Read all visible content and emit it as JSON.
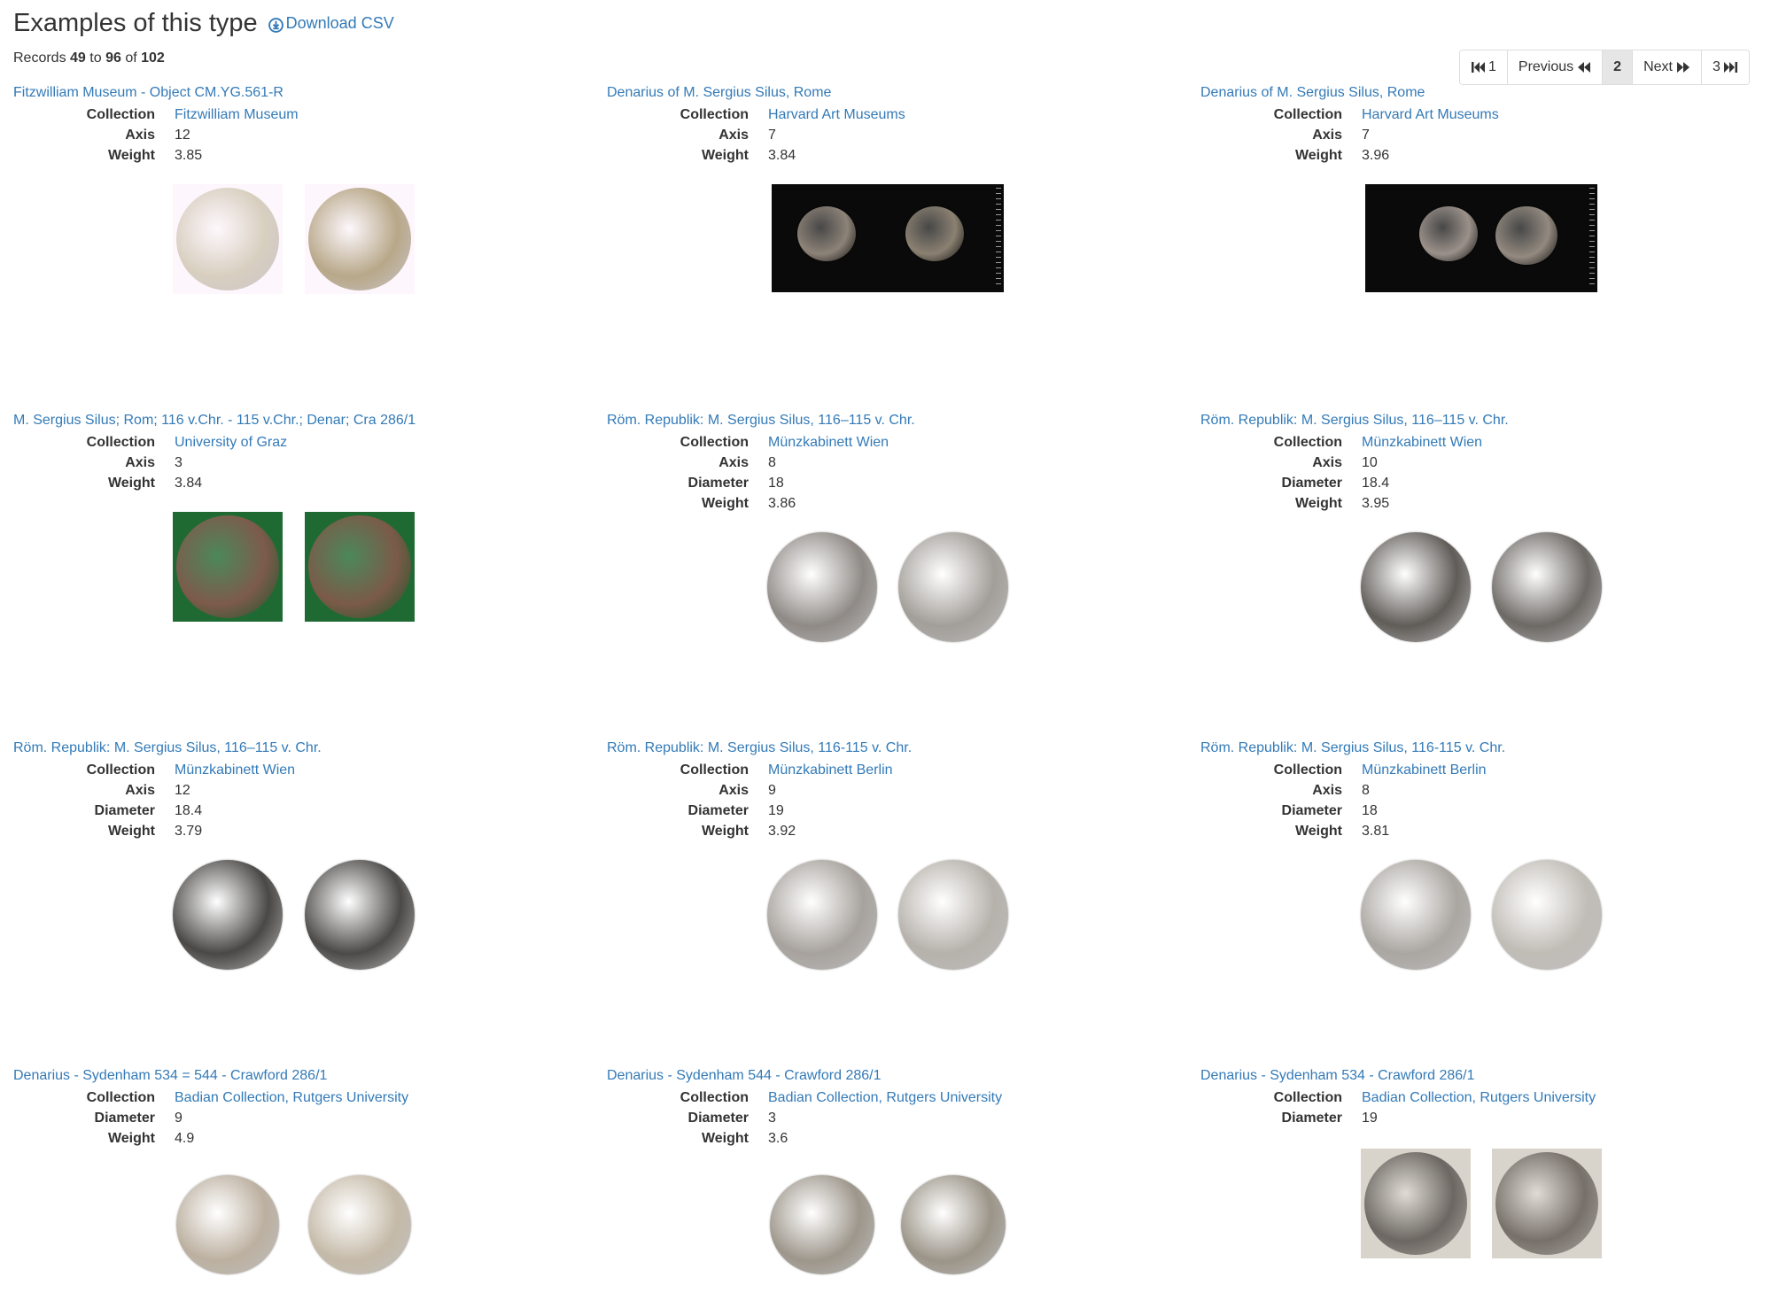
{
  "header": {
    "title": "Examples of this type",
    "download_label": "Download CSV"
  },
  "records": {
    "prefix": "Records",
    "from": "49",
    "to_word": "to",
    "to": "96",
    "of_word": "of",
    "total": "102"
  },
  "pagination": {
    "first": "1",
    "previous": "Previous",
    "current": "2",
    "next": "Next",
    "last": "3"
  },
  "cards": [
    {
      "title": "Fitzwilliam Museum - Object CM.YG.561-R",
      "props": [
        {
          "label": "Collection",
          "value": "Fitzwilliam Museum",
          "link": true
        },
        {
          "label": "Axis",
          "value": "12"
        },
        {
          "label": "Weight",
          "value": "3.85"
        }
      ]
    },
    {
      "title": "Denarius of M. Sergius Silus, Rome",
      "props": [
        {
          "label": "Collection",
          "value": "Harvard Art Museums",
          "link": true
        },
        {
          "label": "Axis",
          "value": "7"
        },
        {
          "label": "Weight",
          "value": "3.84"
        }
      ]
    },
    {
      "title": "Denarius of M. Sergius Silus, Rome",
      "props": [
        {
          "label": "Collection",
          "value": "Harvard Art Museums",
          "link": true
        },
        {
          "label": "Axis",
          "value": "7"
        },
        {
          "label": "Weight",
          "value": "3.96"
        }
      ]
    },
    {
      "title": "M. Sergius Silus; Rom; 116 v.Chr. - 115 v.Chr.; Denar; Cra 286/1",
      "props": [
        {
          "label": "Collection",
          "value": "University of Graz",
          "link": true
        },
        {
          "label": "Axis",
          "value": "3"
        },
        {
          "label": "Weight",
          "value": "3.84"
        }
      ]
    },
    {
      "title": "Röm. Republik: M. Sergius Silus, 116–115 v. Chr.",
      "props": [
        {
          "label": "Collection",
          "value": "Münzkabinett Wien",
          "link": true
        },
        {
          "label": "Axis",
          "value": "8"
        },
        {
          "label": "Diameter",
          "value": "18"
        },
        {
          "label": "Weight",
          "value": "3.86"
        }
      ]
    },
    {
      "title": "Röm. Republik: M. Sergius Silus, 116–115 v. Chr.",
      "props": [
        {
          "label": "Collection",
          "value": "Münzkabinett Wien",
          "link": true
        },
        {
          "label": "Axis",
          "value": "10"
        },
        {
          "label": "Diameter",
          "value": "18.4"
        },
        {
          "label": "Weight",
          "value": "3.95"
        }
      ]
    },
    {
      "title": "Röm. Republik: M. Sergius Silus, 116–115 v. Chr.",
      "props": [
        {
          "label": "Collection",
          "value": "Münzkabinett Wien",
          "link": true
        },
        {
          "label": "Axis",
          "value": "12"
        },
        {
          "label": "Diameter",
          "value": "18.4"
        },
        {
          "label": "Weight",
          "value": "3.79"
        }
      ]
    },
    {
      "title": "Röm. Republik: M. Sergius Silus, 116-115 v. Chr.",
      "props": [
        {
          "label": "Collection",
          "value": "Münzkabinett Berlin",
          "link": true
        },
        {
          "label": "Axis",
          "value": "9"
        },
        {
          "label": "Diameter",
          "value": "19"
        },
        {
          "label": "Weight",
          "value": "3.92"
        }
      ]
    },
    {
      "title": "Röm. Republik: M. Sergius Silus, 116-115 v. Chr.",
      "props": [
        {
          "label": "Collection",
          "value": "Münzkabinett Berlin",
          "link": true
        },
        {
          "label": "Axis",
          "value": "8"
        },
        {
          "label": "Diameter",
          "value": "18"
        },
        {
          "label": "Weight",
          "value": "3.81"
        }
      ]
    },
    {
      "title": "Denarius - Sydenham 534 = 544 - Crawford 286/1",
      "props": [
        {
          "label": "Collection",
          "value": "Badian Collection, Rutgers University",
          "link": true
        },
        {
          "label": "Diameter",
          "value": "9"
        },
        {
          "label": "Weight",
          "value": "4.9"
        }
      ]
    },
    {
      "title": "Denarius - Sydenham 544 - Crawford 286/1",
      "props": [
        {
          "label": "Collection",
          "value": "Badian Collection, Rutgers University",
          "link": true
        },
        {
          "label": "Diameter",
          "value": "3"
        },
        {
          "label": "Weight",
          "value": "3.6"
        }
      ]
    },
    {
      "title": "Denarius - Sydenham 534 - Crawford 286/1",
      "props": [
        {
          "label": "Collection",
          "value": "Badian Collection, Rutgers University",
          "link": true
        },
        {
          "label": "Diameter",
          "value": "19"
        }
      ]
    }
  ],
  "colors": {
    "link": "#337ab7",
    "text": "#333333",
    "active_page_bg": "#e6e6e6"
  }
}
